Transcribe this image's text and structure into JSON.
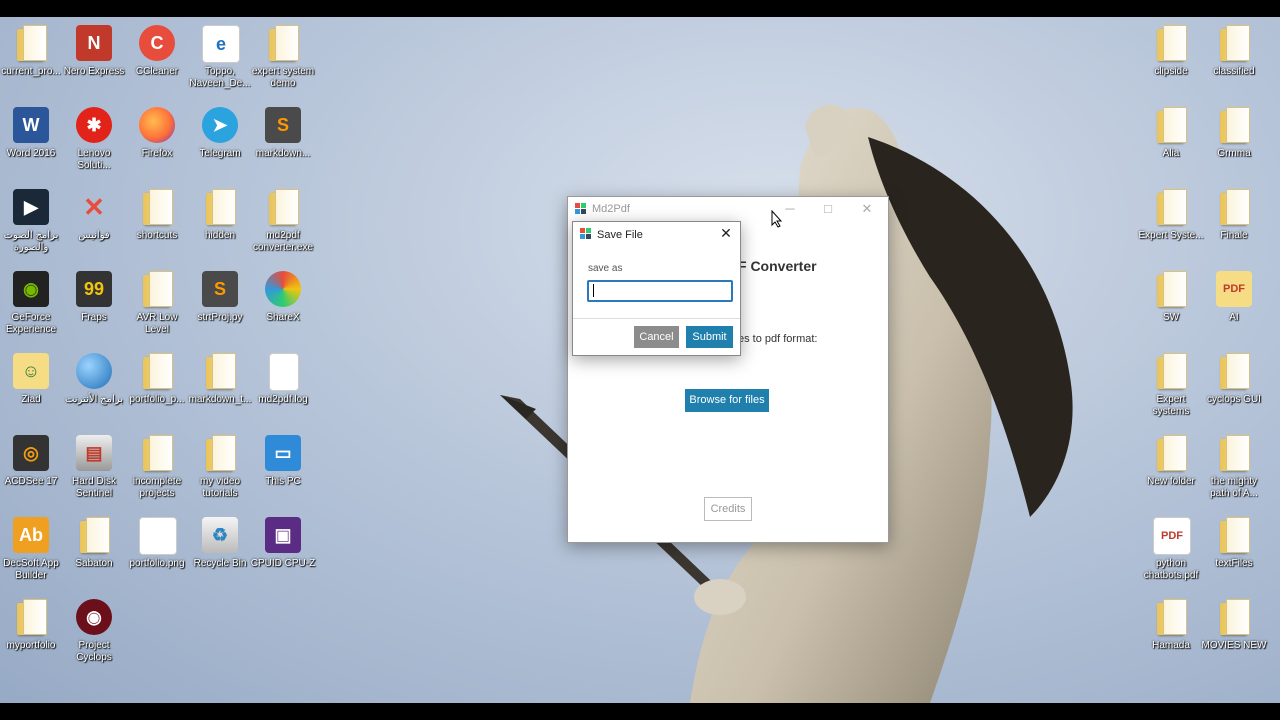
{
  "desktop": {
    "left_icons": [
      {
        "label": "current_pro...",
        "icon": "folder-icon"
      },
      {
        "label": "Nero Express",
        "icon": "nero-express-icon"
      },
      {
        "label": "CCleaner",
        "icon": "ccleaner-icon"
      },
      {
        "label": "Toppo, Naveen_De...",
        "icon": "edge-document-icon"
      },
      {
        "label": "expert system demo",
        "icon": "sublime-folder-icon"
      },
      {
        "label": "Word 2016",
        "icon": "word-icon"
      },
      {
        "label": "Lenovo Soluti...",
        "icon": "lenovo-icon"
      },
      {
        "label": "Firefox",
        "icon": "firefox-icon"
      },
      {
        "label": "Telegram",
        "icon": "telegram-icon"
      },
      {
        "label": "markdown...",
        "icon": "sublime-icon"
      },
      {
        "label": "برامج الصوت والصورة",
        "icon": "media-folder-icon"
      },
      {
        "label": "فوانيس",
        "icon": "tools-icon"
      },
      {
        "label": "shortcuts",
        "icon": "folder-icon"
      },
      {
        "label": "hidden",
        "icon": "folder-icon"
      },
      {
        "label": "md2pdf converter.exe",
        "icon": "exe-folder-icon"
      },
      {
        "label": "GeForce Experience",
        "icon": "nvidia-icon"
      },
      {
        "label": "Fraps",
        "icon": "fraps-icon"
      },
      {
        "label": "AVR Low Level",
        "icon": "folder-icon"
      },
      {
        "label": "strtProj.py",
        "icon": "sublime-icon"
      },
      {
        "label": "ShareX",
        "icon": "sharex-icon"
      },
      {
        "label": "Ziad",
        "icon": "user-folder-icon"
      },
      {
        "label": "برامج الأنترنت",
        "icon": "globe-icon"
      },
      {
        "label": "portfolio_p...",
        "icon": "folder-icon"
      },
      {
        "label": "markdown_t...",
        "icon": "sublime-folder-icon"
      },
      {
        "label": "md2pdf.log",
        "icon": "text-file-icon"
      },
      {
        "label": "ACDSee 17",
        "icon": "acdsee-icon"
      },
      {
        "label": "Hard Disk Sentinel",
        "icon": "hard-disk-icon"
      },
      {
        "label": "incomplete projects",
        "icon": "sublime-folder-icon"
      },
      {
        "label": "my video tutorials",
        "icon": "folder-icon"
      },
      {
        "label": "This PC",
        "icon": "computer-icon"
      },
      {
        "label": "DecSoft App Builder",
        "icon": "app-builder-icon"
      },
      {
        "label": "Sabaton",
        "icon": "folder-icon"
      },
      {
        "label": "portfolio.png",
        "icon": "image-file-icon"
      },
      {
        "label": "Recycle Bin",
        "icon": "recycle-bin-icon"
      },
      {
        "label": "CPUID CPU-Z",
        "icon": "cpu-z-icon"
      },
      {
        "label": "myportfolio",
        "icon": "folder-icon"
      },
      {
        "label": "Project Cyclops",
        "icon": "cyclops-icon"
      }
    ],
    "right_icons": [
      {
        "label": "clipside",
        "icon": "folder-icon"
      },
      {
        "label": "classified",
        "icon": "folder-icon"
      },
      {
        "label": "Alia",
        "icon": "folder-icon"
      },
      {
        "label": "Grmma",
        "icon": "folder-icon"
      },
      {
        "label": "Expert Syste...",
        "icon": "folder-icon"
      },
      {
        "label": "Finale",
        "icon": "folder-icon"
      },
      {
        "label": "SW",
        "icon": "folder-icon"
      },
      {
        "label": "AI",
        "icon": "pdf-folder-icon"
      },
      {
        "label": "Expert systems",
        "icon": "folder-icon"
      },
      {
        "label": "cyclops GUI",
        "icon": "folder-icon"
      },
      {
        "label": "New folder",
        "icon": "folder-icon"
      },
      {
        "label": "the mighty path of A...",
        "icon": "folder-icon"
      },
      {
        "label": "python chatbots.pdf",
        "icon": "pdf-icon"
      },
      {
        "label": "textFiles",
        "icon": "folder-icon"
      },
      {
        "label": "Hamada",
        "icon": "folder-icon"
      },
      {
        "label": "MOVIES NEW",
        "icon": "folder-icon"
      }
    ]
  },
  "md2pdf_window": {
    "title": "Md2Pdf",
    "heading": "F Converter",
    "description": "es to pdf format:",
    "browse_label": "Browse for files",
    "credits_label": "Credits",
    "minimize_glyph": "─",
    "maximize_glyph": "□",
    "close_glyph": "✕"
  },
  "save_dialog": {
    "title": "Save File",
    "close_glyph": "✕",
    "field_label": "save as",
    "field_value": "",
    "cancel_label": "Cancel",
    "submit_label": "Submit"
  },
  "colors": {
    "accent": "#1f7fad",
    "cancel": "#8c8c8c"
  }
}
